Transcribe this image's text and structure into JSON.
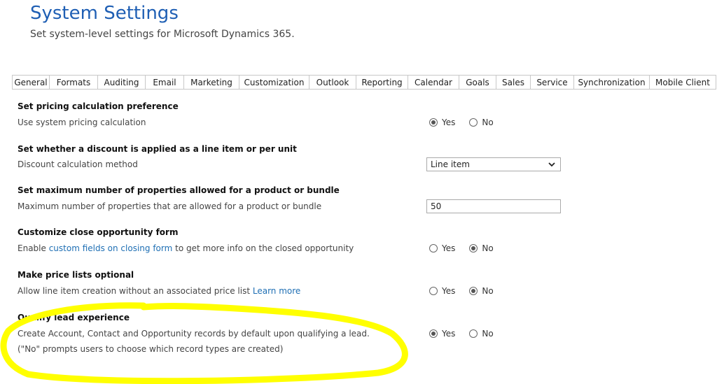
{
  "header": {
    "title": "System Settings",
    "subtitle": "Set system-level settings for Microsoft Dynamics 365."
  },
  "tabs": [
    {
      "label": "General"
    },
    {
      "label": "Formats"
    },
    {
      "label": "Auditing"
    },
    {
      "label": "Email"
    },
    {
      "label": "Marketing"
    },
    {
      "label": "Customization"
    },
    {
      "label": "Outlook"
    },
    {
      "label": "Reporting"
    },
    {
      "label": "Calendar"
    },
    {
      "label": "Goals"
    },
    {
      "label": "Sales",
      "active": true
    },
    {
      "label": "Service"
    },
    {
      "label": "Synchronization"
    },
    {
      "label": "Mobile Client"
    }
  ],
  "sections": {
    "pricing": {
      "title": "Set pricing calculation preference",
      "desc": "Use system pricing calculation",
      "yes": "Yes",
      "no": "No",
      "selected": "Yes"
    },
    "discount": {
      "title": "Set whether a discount is applied as a line item or per unit",
      "desc": "Discount calculation method",
      "value": "Line item"
    },
    "properties": {
      "title": "Set maximum number of properties allowed for a product or bundle",
      "desc": "Maximum number of properties that are allowed for a product or bundle",
      "value": "50"
    },
    "close_opp": {
      "title": "Customize close opportunity form",
      "desc_prefix": "Enable ",
      "desc_link": "custom fields on closing form",
      "desc_suffix": " to get more info on the closed opportunity",
      "yes": "Yes",
      "no": "No",
      "selected": "No"
    },
    "price_lists": {
      "title": "Make price lists optional",
      "desc_prefix": "Allow line item creation without an associated price list ",
      "desc_link": "Learn more",
      "yes": "Yes",
      "no": "No",
      "selected": "No"
    },
    "qualify": {
      "title": "Qualify lead experience",
      "desc1": "Create Account, Contact and Opportunity records by default upon qualifying a lead.",
      "desc2": "(\"No\" prompts users to choose which record types are created)",
      "yes": "Yes",
      "no": "No",
      "selected": "Yes"
    }
  },
  "colors": {
    "title": "#1f5fb4",
    "link": "#1f6fb4",
    "highlight": "#ffff00"
  },
  "icons": {
    "select_chevron": "chevron-down-icon"
  }
}
